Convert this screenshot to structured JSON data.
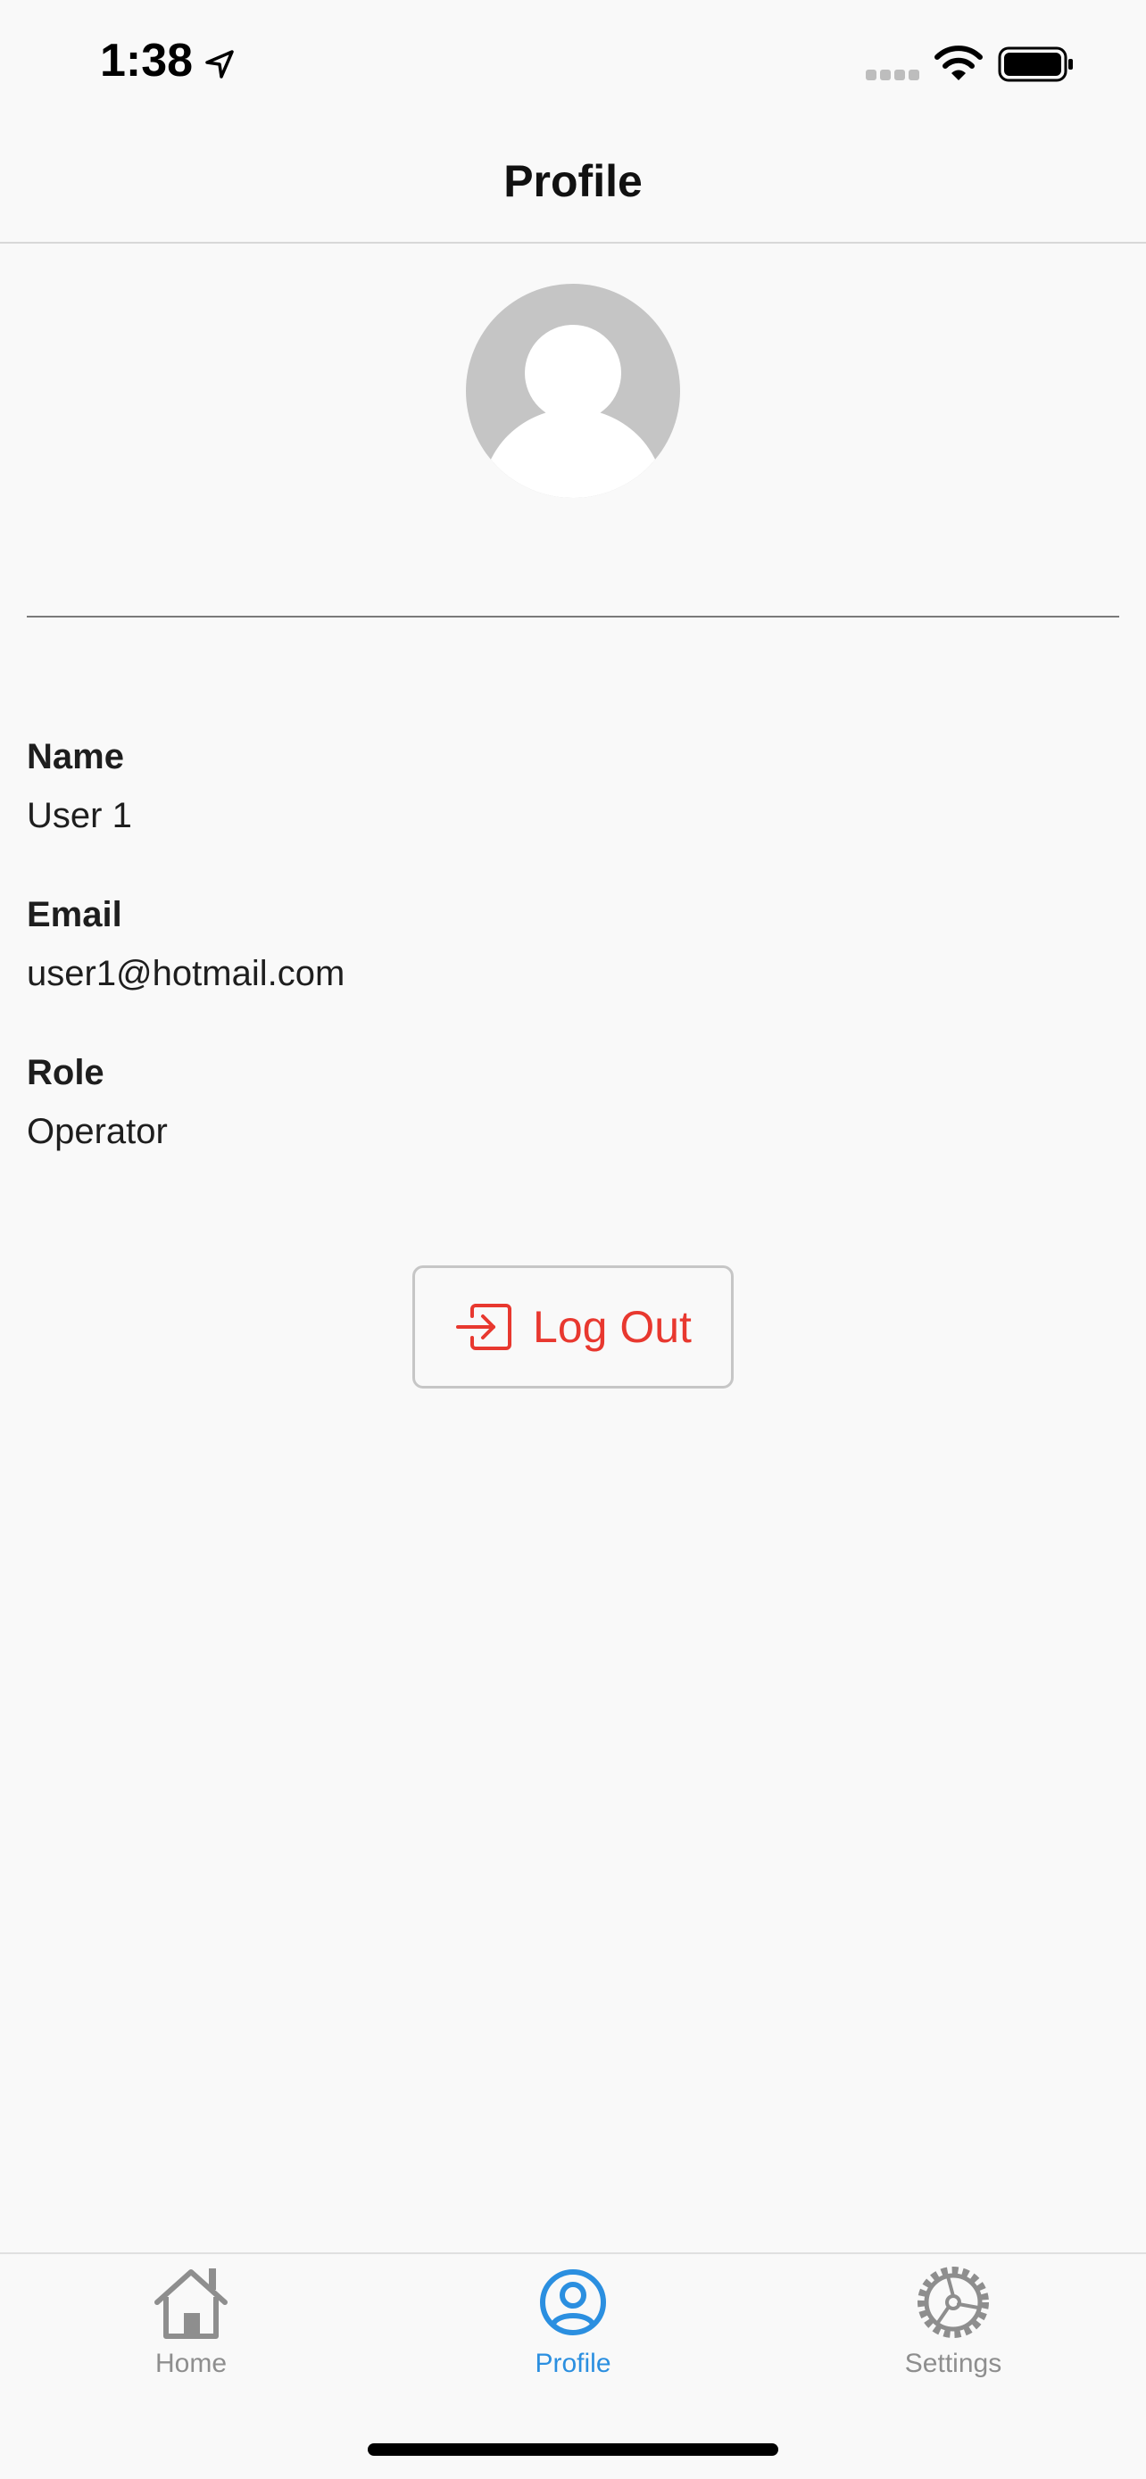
{
  "status_bar": {
    "time": "1:38"
  },
  "header": {
    "title": "Profile"
  },
  "profile": {
    "fields": [
      {
        "label": "Name",
        "value": "User 1"
      },
      {
        "label": "Email",
        "value": "user1@hotmail.com"
      },
      {
        "label": "Role",
        "value": "Operator"
      }
    ]
  },
  "logout": {
    "label": "Log Out",
    "icon": "logout-icon",
    "color": "#e8382f"
  },
  "tabs": [
    {
      "label": "Home",
      "icon": "home-icon",
      "active": false
    },
    {
      "label": "Profile",
      "icon": "user-circle-icon",
      "active": true
    },
    {
      "label": "Settings",
      "icon": "gear-icon",
      "active": false
    }
  ],
  "colors": {
    "accent": "#2b8fe0",
    "inactive": "#8e8e8e",
    "avatar_bg": "#c5c5c5"
  }
}
